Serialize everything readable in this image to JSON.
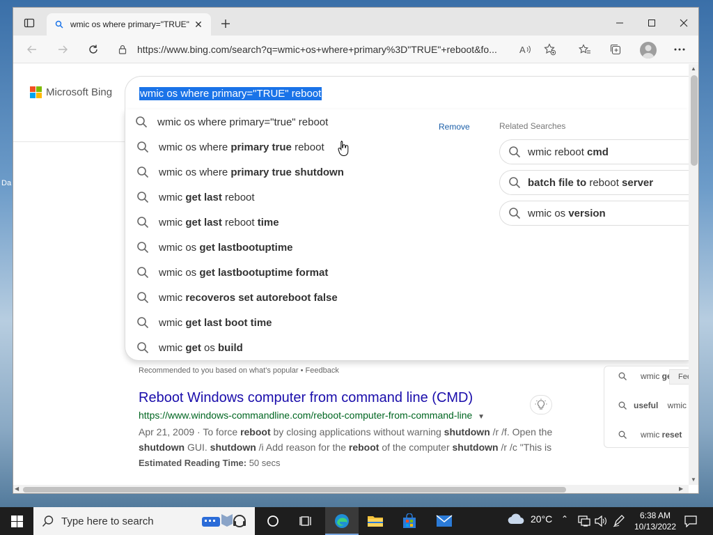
{
  "desktop": {
    "label": "Da"
  },
  "browser": {
    "tab": {
      "title": "wmic os where primary=\"TRUE\""
    },
    "address_bar": {
      "url": "https://www.bing.com/search?q=wmic+os+where+primary%3D\"TRUE\"+reboot&fo..."
    }
  },
  "bing": {
    "logo_text": "Microsoft Bing",
    "logo_colors": [
      "#f25022",
      "#7fba00",
      "#00a4ef",
      "#ffb900"
    ],
    "search_query": "wmic os where primary=\"TRUE\" reboot",
    "history_item": {
      "text": "wmic os where primary=\"true\" reboot",
      "remove_label": "Remove"
    },
    "suggestions": [
      [
        {
          "t": "wmic os where ",
          "b": false
        },
        {
          "t": "primary true",
          "b": true
        },
        {
          "t": " reboot",
          "b": false
        }
      ],
      [
        {
          "t": "wmic os where ",
          "b": false
        },
        {
          "t": "primary true shutdown",
          "b": true
        }
      ],
      [
        {
          "t": "wmic ",
          "b": false
        },
        {
          "t": "get last",
          "b": true
        },
        {
          "t": " reboot",
          "b": false
        }
      ],
      [
        {
          "t": "wmic ",
          "b": false
        },
        {
          "t": "get last",
          "b": true
        },
        {
          "t": " reboot ",
          "b": false
        },
        {
          "t": "time",
          "b": true
        }
      ],
      [
        {
          "t": "wmic os ",
          "b": false
        },
        {
          "t": "get lastbootuptime",
          "b": true
        }
      ],
      [
        {
          "t": "wmic os ",
          "b": false
        },
        {
          "t": "get lastbootuptime format",
          "b": true
        }
      ],
      [
        {
          "t": "wmic ",
          "b": false
        },
        {
          "t": "recoveros set autoreboot false",
          "b": true
        }
      ],
      [
        {
          "t": "wmic ",
          "b": false
        },
        {
          "t": "get last boot time",
          "b": true
        }
      ],
      [
        {
          "t": "wmic ",
          "b": false
        },
        {
          "t": "get",
          "b": true
        },
        {
          "t": " os ",
          "b": false
        },
        {
          "t": "build",
          "b": true
        }
      ]
    ],
    "related_title": "Related Searches",
    "related": [
      [
        {
          "t": "wmic reboot ",
          "b": false
        },
        {
          "t": "cmd",
          "b": true
        }
      ],
      [
        {
          "t": "batch file to",
          "b": true
        },
        {
          "t": " reboot ",
          "b": false
        },
        {
          "t": "server",
          "b": true
        }
      ],
      [
        {
          "t": "wmic os ",
          "b": false
        },
        {
          "t": "version",
          "b": true
        }
      ]
    ],
    "recommended_text": "Recommended to you based on what's popular • Feedback"
  },
  "result": {
    "title": "Reboot Windows computer from command line (CMD)",
    "url": "https://www.windows-commandline.com/reboot-computer-from-command-line",
    "snippet": [
      {
        "t": "Apr 21, 2009 · To force ",
        "b": false
      },
      {
        "t": "reboot",
        "b": true
      },
      {
        "t": " by closing applications without warning ",
        "b": false
      },
      {
        "t": "shutdown",
        "b": true
      },
      {
        "t": " /r /f. Open the ",
        "b": false
      },
      {
        "t": "shutdown",
        "b": true
      },
      {
        "t": " GUI. ",
        "b": false
      },
      {
        "t": "shutdown",
        "b": true
      },
      {
        "t": " /i Add reason for the ",
        "b": false
      },
      {
        "t": "reboot",
        "b": true
      },
      {
        "t": " of the computer ",
        "b": false
      },
      {
        "t": "shutdown",
        "b": true
      },
      {
        "t": " /r /c \"This is ...",
        "b": false
      }
    ],
    "reading_label": "Estimated Reading Time:",
    "reading_value": "50 secs"
  },
  "side_panel": {
    "items": [
      [
        {
          "t": "wmic ",
          "b": false
        },
        {
          "t": "ge",
          "b": true
        }
      ],
      [
        {
          "t": "useful",
          "b": true
        },
        {
          "t": " wmic c",
          "b": false
        }
      ],
      [
        {
          "t": "wmic ",
          "b": false
        },
        {
          "t": "reset",
          "b": true
        }
      ]
    ],
    "feedback_tab": "Fee"
  },
  "taskbar": {
    "search_placeholder": "Type here to search",
    "weather": "20°C",
    "time": "6:38 AM",
    "date": "10/13/2022"
  }
}
